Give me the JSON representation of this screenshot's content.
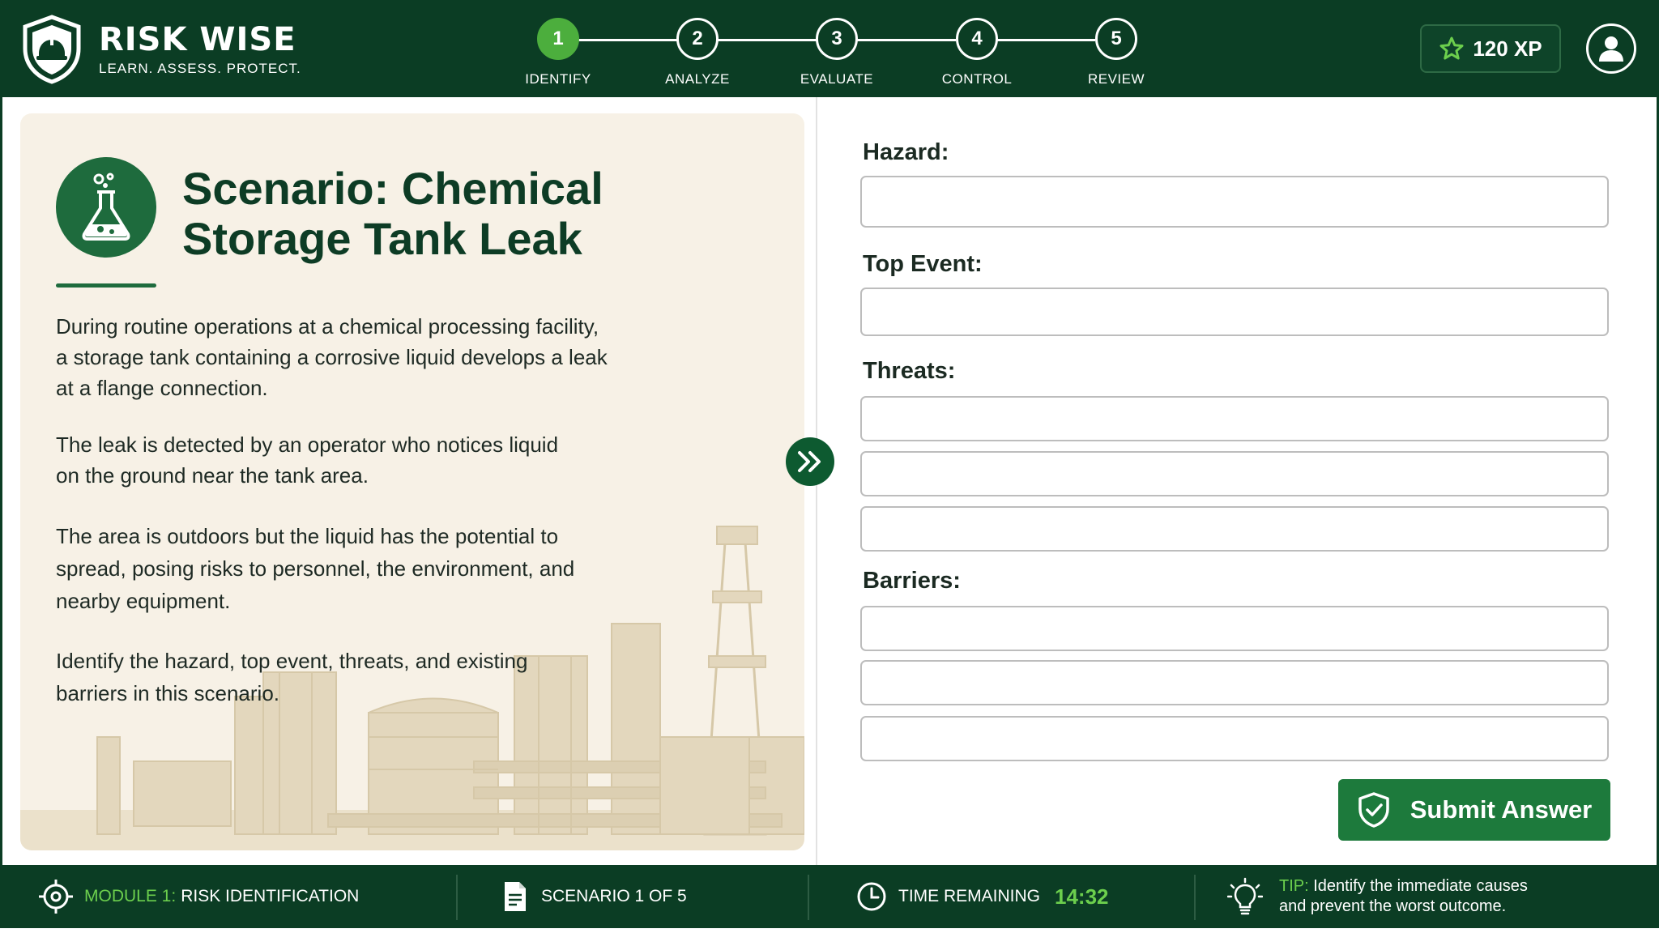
{
  "brand": {
    "title": "RISK WISE",
    "tagline": "LEARN. ASSESS. PROTECT."
  },
  "stepper": {
    "active_step": 1,
    "steps": [
      {
        "number": "1",
        "label": "IDENTIFY"
      },
      {
        "number": "2",
        "label": "ANALYZE"
      },
      {
        "number": "3",
        "label": "EVALUATE"
      },
      {
        "number": "4",
        "label": "CONTROL"
      },
      {
        "number": "5",
        "label": "REVIEW"
      }
    ]
  },
  "xp": {
    "label": "120 XP",
    "icon": "star-icon"
  },
  "user": {
    "icon": "user-icon"
  },
  "scenario": {
    "icon": "flask-icon",
    "title_line1": "Scenario: Chemical",
    "title_line2": "Storage Tank Leak",
    "paragraphs": [
      {
        "lines": [
          "During routine operations at a chemical processing facility,",
          "a storage tank containing a corrosive liquid develops a leak",
          "at a flange connection."
        ]
      },
      {
        "lines": [
          "The leak is detected by an operator who notices liquid",
          "on the ground near the tank area."
        ]
      },
      {
        "lines": [
          "The area is outdoors but the liquid has the potential to",
          "spread, posing risks to personnel, the environment, and",
          "nearby equipment."
        ]
      },
      {
        "lines": [
          "Identify the hazard, top event, threats, and existing",
          "barriers in this scenario."
        ]
      }
    ]
  },
  "form": {
    "hazard_label": "Hazard:",
    "top_event_label": "Top Event:",
    "threats_label": "Threats:",
    "barriers_label": "Barriers:",
    "hazard_value": "",
    "top_event_value": "",
    "threats_values": [
      "",
      "",
      ""
    ],
    "barriers_values": [
      "",
      "",
      ""
    ],
    "submit_label": "Submit Answer"
  },
  "footer": {
    "module_prefix": "MODULE 1:",
    "module_name": "RISK IDENTIFICATION",
    "scenario_progress": "SCENARIO 1 OF 5",
    "time_label": "TIME REMAINING",
    "time_value": "14:32",
    "tip_prefix": "TIP:",
    "tip_line1": "Identify the immediate causes",
    "tip_line2": "and prevent the worst outcome."
  },
  "colors": {
    "header_bg": "#0b3d24",
    "accent_green": "#4cae3d",
    "button_green": "#1d7a3c",
    "card_bg": "#f7f1e6",
    "title_green": "#0d3c25"
  }
}
